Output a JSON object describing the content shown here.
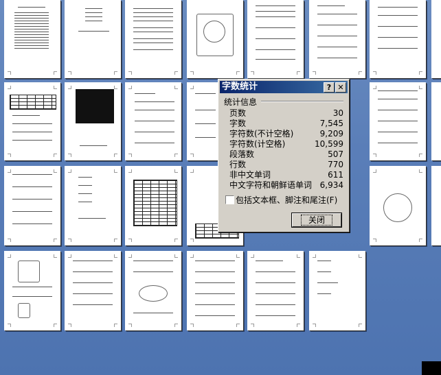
{
  "dialog": {
    "title": "字数统计",
    "help_button": "?",
    "close_x": "✕",
    "group_label": "统计信息",
    "stats": [
      {
        "label": "页数",
        "value": "30"
      },
      {
        "label": "字数",
        "value": "7,545"
      },
      {
        "label": "字符数(不计空格)",
        "value": "9,209"
      },
      {
        "label": "字符数(计空格)",
        "value": "10,599"
      },
      {
        "label": "段落数",
        "value": "507"
      },
      {
        "label": "行数",
        "value": "770"
      },
      {
        "label": "非中文单词",
        "value": "611"
      },
      {
        "label": "中文字符和朝鲜语单词",
        "value": "6,934"
      }
    ],
    "checkbox_label": "包括文本框、脚注和尾注(F)",
    "checkbox_checked": false,
    "close_button": "关闭"
  }
}
